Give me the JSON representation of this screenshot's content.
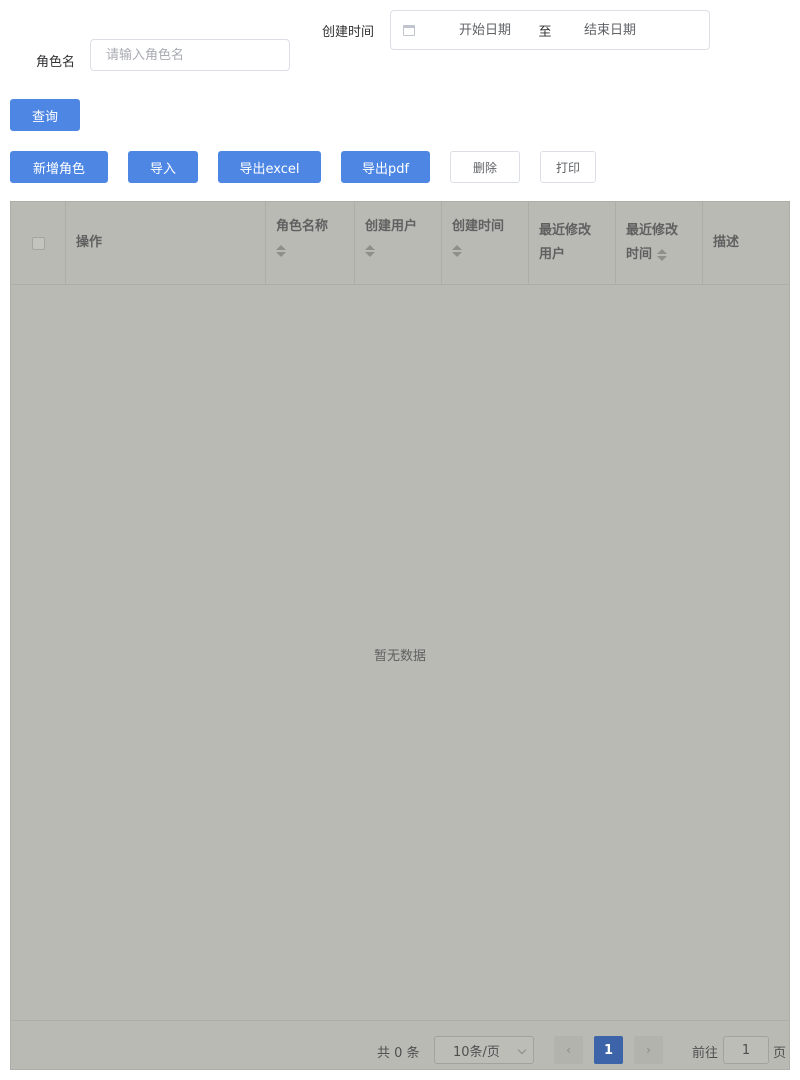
{
  "search": {
    "role_name_label": "角色名",
    "role_name_placeholder": "请输入角色名",
    "created_time_label": "创建时间",
    "start_placeholder": "开始日期",
    "range_separator": "至",
    "end_placeholder": "结束日期",
    "query_button": "查询"
  },
  "toolbar": {
    "add_role": "新增角色",
    "import": "导入",
    "export_excel": "导出excel",
    "export_pdf": "导出pdf",
    "delete": "删除",
    "print": "打印"
  },
  "table": {
    "columns": [
      {
        "label": "操作",
        "sortable": false
      },
      {
        "label": "角色名称",
        "sortable": true
      },
      {
        "label": "创建用户",
        "sortable": true
      },
      {
        "label": "创建时间",
        "sortable": true
      },
      {
        "label_line1": "最近修改",
        "label_line2": "用户",
        "sortable": false
      },
      {
        "label_line1": "最近修改",
        "label_line2": "时间",
        "sortable": true
      },
      {
        "label": "描述",
        "sortable": false
      }
    ],
    "empty_text": "暂无数据"
  },
  "pagination": {
    "total_text": "共 0 条",
    "page_size": "10条/页",
    "current_page": "1",
    "goto_label": "前往",
    "goto_value": "1",
    "page_suffix": "页"
  },
  "colors": {
    "primary": "#4e86e4",
    "overlay": "#babab5",
    "active_page": "#3d63a8"
  }
}
